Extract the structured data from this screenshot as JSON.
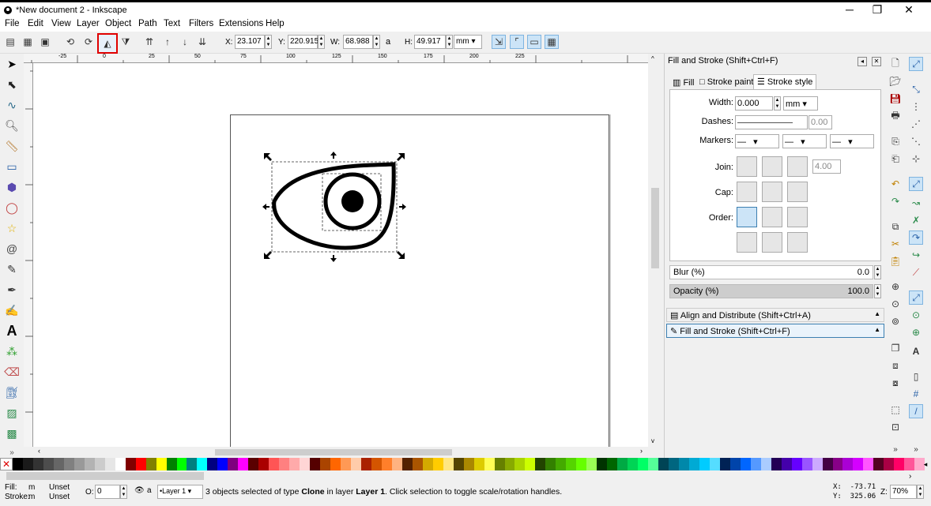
{
  "window": {
    "title": "*New document 2 - Inkscape",
    "minimize": "─",
    "maximize": "❐",
    "close": "✕"
  },
  "menu": [
    "File",
    "Edit",
    "View",
    "Layer",
    "Object",
    "Path",
    "Text",
    "Filters",
    "Extensions",
    "Help"
  ],
  "toolbar": {
    "x_label": "X:",
    "x_value": "23.107",
    "y_label": "Y:",
    "y_value": "220.915",
    "w_label": "W:",
    "w_value": "68.988",
    "h_label": "H:",
    "h_value": "49.917",
    "unit": "mm"
  },
  "ruler_ticks": [
    "-25",
    "0",
    "25",
    "50",
    "75",
    "100",
    "125",
    "150",
    "175",
    "200",
    "225"
  ],
  "panel": {
    "title": "Fill and Stroke (Shift+Ctrl+F)",
    "tabs": [
      "Fill",
      "Stroke paint",
      "Stroke style"
    ],
    "width_label": "Width:",
    "width_value": "0.000",
    "width_unit": "mm",
    "dashes_label": "Dashes:",
    "dashes_value": "0.00",
    "markers_label": "Markers:",
    "join_label": "Join:",
    "join_value": "4.00",
    "cap_label": "Cap:",
    "order_label": "Order:",
    "blur_label": "Blur (%)",
    "blur_value": "0.0",
    "opacity_label": "Opacity (%)",
    "opacity_value": "100.0",
    "docked1": "Align and Distribute (Shift+Ctrl+A)",
    "docked2": "Fill and Stroke (Shift+Ctrl+F)"
  },
  "status": {
    "fill_label": "Fill:",
    "fill_value": "m",
    "fill_unset": "Unset",
    "stroke_label": "Stroke:",
    "stroke_value": "m",
    "stroke_unset": "Unset",
    "opacity_label": "O:",
    "opacity_value": "0",
    "layer": "•Layer 1",
    "msg_pre": "3 objects selected of type ",
    "msg_type": "Clone",
    "msg_mid": " in layer ",
    "msg_layer": "Layer 1",
    "msg_post": ". Click selection to toggle scale/rotation handles.",
    "x_coord": "X:  -73.71",
    "y_coord": "Y:  325.06",
    "zoom_label": "Z:",
    "zoom_value": "70%"
  },
  "palette_colors": [
    "#000000",
    "#1a1a1a",
    "#333333",
    "#4d4d4d",
    "#666666",
    "#808080",
    "#999999",
    "#b3b3b3",
    "#cccccc",
    "#e6e6e6",
    "#ffffff",
    "#800000",
    "#ff0000",
    "#808000",
    "#ffff00",
    "#008000",
    "#00ff00",
    "#008080",
    "#00ffff",
    "#000080",
    "#0000ff",
    "#800080",
    "#ff00ff",
    "#5a0000",
    "#aa0000",
    "#ff5555",
    "#ff8080",
    "#ffaaaa",
    "#ffd5d5",
    "#550000",
    "#aa4400",
    "#ff6600",
    "#ff9955",
    "#ffccaa",
    "#aa2200",
    "#d45500",
    "#ff7f2a",
    "#ffb380",
    "#552200",
    "#aa5500",
    "#d4aa00",
    "#ffcc00",
    "#ffe680",
    "#554400",
    "#aa8800",
    "#ddcc00",
    "#ffff55",
    "#668000",
    "#88aa00",
    "#aad400",
    "#ccff00",
    "#224400",
    "#338000",
    "#44aa00",
    "#55d400",
    "#66ff00",
    "#99ff55",
    "#003300",
    "#006600",
    "#00aa44",
    "#00d455",
    "#00ff66",
    "#55ff99",
    "#004455",
    "#006680",
    "#0088aa",
    "#00aad4",
    "#00ccff",
    "#55ddff",
    "#002255",
    "#0044aa",
    "#0066ff",
    "#5599ff",
    "#aaccff",
    "#220055",
    "#4400aa",
    "#6600ff",
    "#9955ff",
    "#ccaaff",
    "#440044",
    "#880088",
    "#aa00d4",
    "#d400ff",
    "#ff55ff",
    "#550022",
    "#aa0044",
    "#ff0066",
    "#ff5599",
    "#ffaacc"
  ]
}
